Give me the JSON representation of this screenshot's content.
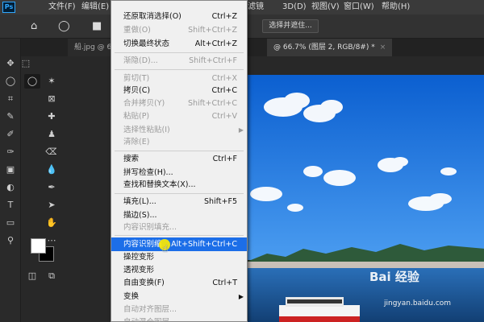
{
  "menubar": {
    "logo": "Ps",
    "items": [
      "文件(F)",
      "编辑(E)",
      "滤镜",
      "3D(D)",
      "视图(V)",
      "窗口(W)",
      "帮助(H)"
    ]
  },
  "optionsbar": {
    "select_subject": "选择并遮住..."
  },
  "tabs": {
    "left": "船.jpg @ 66",
    "right": "@ 66.7% (图层 2, RGB/8#) *",
    "close": "×"
  },
  "edit_menu": {
    "items": [
      {
        "label": "还原取消选择(O)",
        "shortcut": "Ctrl+Z",
        "disabled": false
      },
      {
        "label": "重做(O)",
        "shortcut": "Shift+Ctrl+Z",
        "disabled": true
      },
      {
        "label": "切换最终状态",
        "shortcut": "Alt+Ctrl+Z",
        "disabled": false
      },
      {
        "label": "渐隐(D)...",
        "shortcut": "Shift+Ctrl+F",
        "disabled": true
      },
      {
        "label": "剪切(T)",
        "shortcut": "Ctrl+X",
        "disabled": true
      },
      {
        "label": "拷贝(C)",
        "shortcut": "Ctrl+C",
        "disabled": false
      },
      {
        "label": "合并拷贝(Y)",
        "shortcut": "Shift+Ctrl+C",
        "disabled": true
      },
      {
        "label": "粘贴(P)",
        "shortcut": "Ctrl+V",
        "disabled": true
      },
      {
        "label": "选择性粘贴(I)",
        "shortcut": "",
        "disabled": true
      },
      {
        "label": "清除(E)",
        "shortcut": "",
        "disabled": true
      },
      {
        "label": "搜索",
        "shortcut": "Ctrl+F",
        "disabled": false
      },
      {
        "label": "拼写检查(H)...",
        "shortcut": "",
        "disabled": false
      },
      {
        "label": "查找和替换文本(X)...",
        "shortcut": "",
        "disabled": false
      },
      {
        "label": "填充(L)...",
        "shortcut": "Shift+F5",
        "disabled": false
      },
      {
        "label": "描边(S)...",
        "shortcut": "",
        "disabled": false
      },
      {
        "label": "内容识别填充...",
        "shortcut": "",
        "disabled": true
      },
      {
        "label": "内容识别缩",
        "shortcut": "Alt+Shift+Ctrl+C",
        "disabled": false,
        "highlighted": true
      },
      {
        "label": "操控变形",
        "shortcut": "",
        "disabled": false
      },
      {
        "label": "透视变形",
        "shortcut": "",
        "disabled": false
      },
      {
        "label": "自由变换(F)",
        "shortcut": "Ctrl+T",
        "disabled": false
      },
      {
        "label": "变换",
        "shortcut": "",
        "disabled": false
      },
      {
        "label": "自动对齐图层...",
        "shortcut": "",
        "disabled": true
      },
      {
        "label": "自动混合图层...",
        "shortcut": "",
        "disabled": true
      }
    ]
  },
  "watermark": {
    "brand": "Bai 经验",
    "url": "jingyan.baidu.com"
  },
  "colors": {
    "accent": "#1c6ee8",
    "sky": "#1e6fd6",
    "sea": "#1a4f8a"
  }
}
